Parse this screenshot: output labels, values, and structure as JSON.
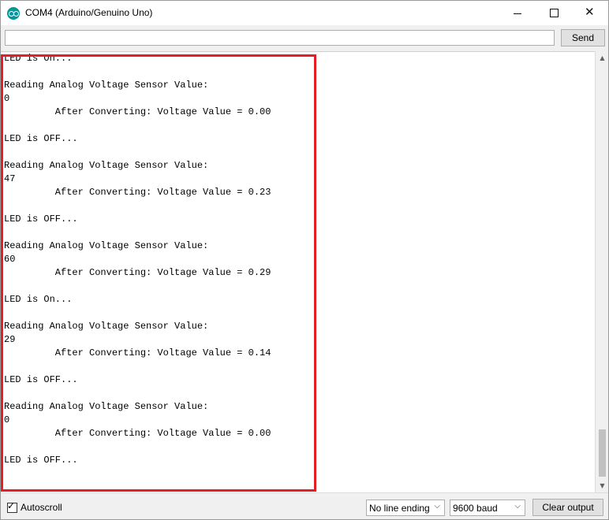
{
  "window": {
    "title": "COM4 (Arduino/Genuino Uno)",
    "controls": {
      "minimize": "minimize-icon",
      "maximize": "maximize-icon",
      "close": "close-icon"
    }
  },
  "send": {
    "input_value": "",
    "button_label": "Send"
  },
  "output": {
    "lines": [
      "LED is On...",
      "",
      "Reading Analog Voltage Sensor Value:",
      "0",
      "         After Converting: Voltage Value = 0.00",
      "",
      "LED is OFF...",
      "",
      "Reading Analog Voltage Sensor Value:",
      "47",
      "         After Converting: Voltage Value = 0.23",
      "",
      "LED is OFF...",
      "",
      "Reading Analog Voltage Sensor Value:",
      "60",
      "         After Converting: Voltage Value = 0.29",
      "",
      "LED is On...",
      "",
      "Reading Analog Voltage Sensor Value:",
      "29",
      "         After Converting: Voltage Value = 0.14",
      "",
      "LED is OFF...",
      "",
      "Reading Analog Voltage Sensor Value:",
      "0",
      "         After Converting: Voltage Value = 0.00",
      "",
      "LED is OFF..."
    ],
    "highlight_color": "#e81c24"
  },
  "bottom": {
    "autoscroll_label": "Autoscroll",
    "autoscroll_checked": true,
    "line_ending": "No line ending",
    "baud": "9600 baud",
    "clear_label": "Clear output"
  },
  "colors": {
    "accent": "#00979c"
  }
}
